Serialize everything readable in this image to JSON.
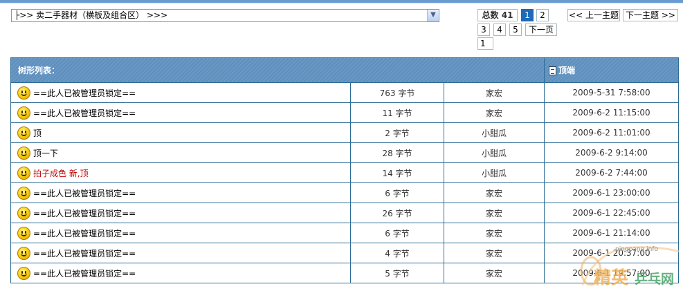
{
  "forum_jump": {
    "selected": "├>> 卖二手器材（横板及组合区） >>>"
  },
  "pager": {
    "total_label": "总数",
    "total_count": "41",
    "pages": [
      "1",
      "2",
      "3",
      "4",
      "5"
    ],
    "current_page": "1",
    "next_page_label": "下一页",
    "jump_value": "1"
  },
  "topic_nav": {
    "prev_label": "<< 上一主题",
    "next_label": "下一主题 >>"
  },
  "table": {
    "tree_list_label": "树形列表：",
    "top_label": "顶端",
    "rows": [
      {
        "title": "==此人已被管理员锁定==",
        "size": "763 字节",
        "author": "家宏",
        "date": "2009-5-31 7:58:00",
        "red": false
      },
      {
        "title": "==此人已被管理员锁定==",
        "size": "11 字节",
        "author": "家宏",
        "date": "2009-6-2 11:15:00",
        "red": false
      },
      {
        "title": "顶",
        "size": "2 字节",
        "author": "小甜瓜",
        "date": "2009-6-2 11:01:00",
        "red": false
      },
      {
        "title": "顶一下",
        "size": "28 字节",
        "author": "小甜瓜",
        "date": "2009-6-2 9:14:00",
        "red": false
      },
      {
        "title": "拍子成色  新,顶",
        "size": "14 字节",
        "author": "小甜瓜",
        "date": "2009-6-2 7:44:00",
        "red": true
      },
      {
        "title": "==此人已被管理员锁定==",
        "size": "6 字节",
        "author": "家宏",
        "date": "2009-6-1 23:00:00",
        "red": false
      },
      {
        "title": "==此人已被管理员锁定==",
        "size": "26 字节",
        "author": "家宏",
        "date": "2009-6-1 22:45:00",
        "red": false
      },
      {
        "title": "==此人已被管理员锁定==",
        "size": "6 字节",
        "author": "家宏",
        "date": "2009-6-1 21:14:00",
        "red": false
      },
      {
        "title": "==此人已被管理员锁定==",
        "size": "4 字节",
        "author": "家宏",
        "date": "2009-6-1 20:37:00",
        "red": false
      },
      {
        "title": "==此人已被管理员锁定==",
        "size": "5 字节",
        "author": "家宏",
        "date": "2009-6-1 19:57:00",
        "red": false
      }
    ]
  },
  "watermark": {
    "site": "pingpang.info",
    "cn_left": "精英",
    "cn_right": "乒乓网"
  },
  "colors": {
    "header_bg": "#5f8fbd",
    "border": "#2d6c96",
    "current_page": "#1e6ab5",
    "red_title": "#c00000"
  }
}
